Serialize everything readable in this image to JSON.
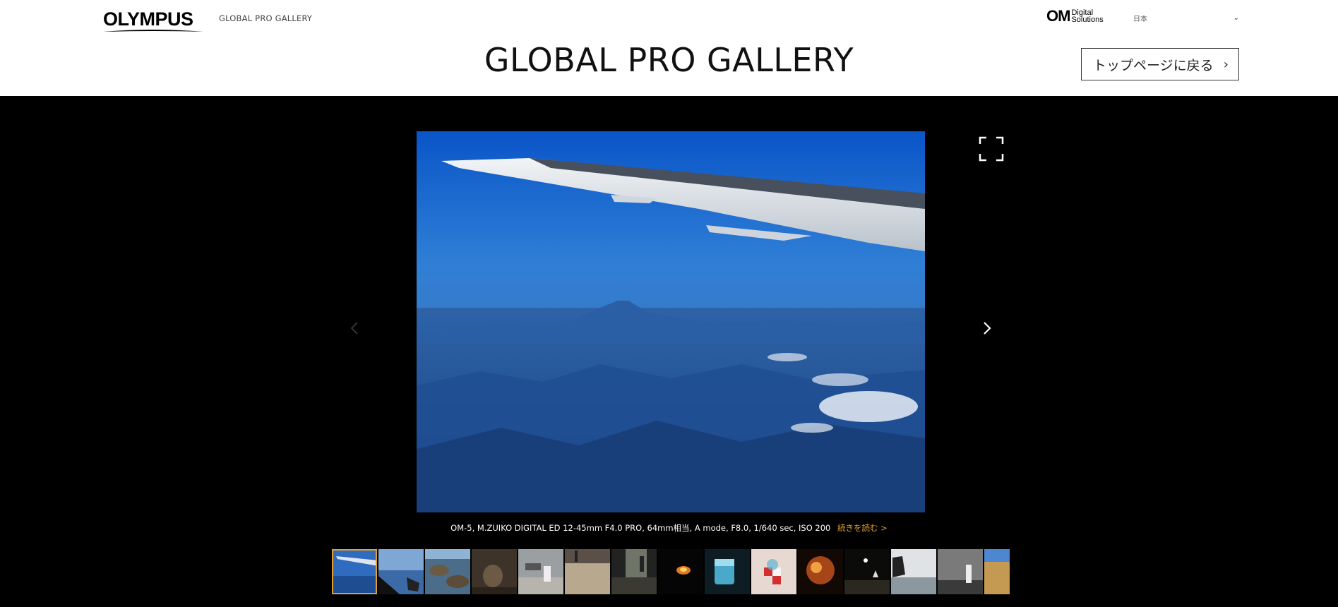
{
  "header": {
    "brand_name": "OLYMPUS",
    "site_name": "GLOBAL PRO GALLERY",
    "partner_logo": {
      "main": "OM",
      "line1": "Digital",
      "line2": "Solutions"
    },
    "language": "日本",
    "page_title": "GLOBAL PRO GALLERY",
    "back_button_label": "トップページに戻る",
    "back_button_arrow": "›"
  },
  "gallery": {
    "caption": "OM-5, M.ZUIKO DIGITAL ED 12-45mm F4.0 PRO, 64mm相当, A mode, F8.0, 1/640 sec, ISO 200",
    "read_more": "続きを読む >",
    "accent_color": "#e0a030",
    "thumbnails": [
      {
        "subject": "airplane-wing-over-mountain",
        "active": true
      },
      {
        "subject": "beach-with-car-mirror",
        "active": false
      },
      {
        "subject": "rocky-coast-pools",
        "active": false
      },
      {
        "subject": "bucket-on-wood",
        "active": false
      },
      {
        "subject": "fisherman-at-stall",
        "active": false
      },
      {
        "subject": "people-on-sand",
        "active": false
      },
      {
        "subject": "dark-doorway",
        "active": false
      },
      {
        "subject": "fire-in-darkness",
        "active": false
      },
      {
        "subject": "glass-of-water",
        "active": false
      },
      {
        "subject": "red-checkered-cloth",
        "active": false
      },
      {
        "subject": "autumn-tree-night",
        "active": false
      },
      {
        "subject": "moon-over-shore",
        "active": false
      },
      {
        "subject": "rock-in-sea",
        "active": false
      },
      {
        "subject": "lighthouse-monochrome",
        "active": false
      },
      {
        "subject": "hay-bales",
        "active": false
      }
    ]
  }
}
